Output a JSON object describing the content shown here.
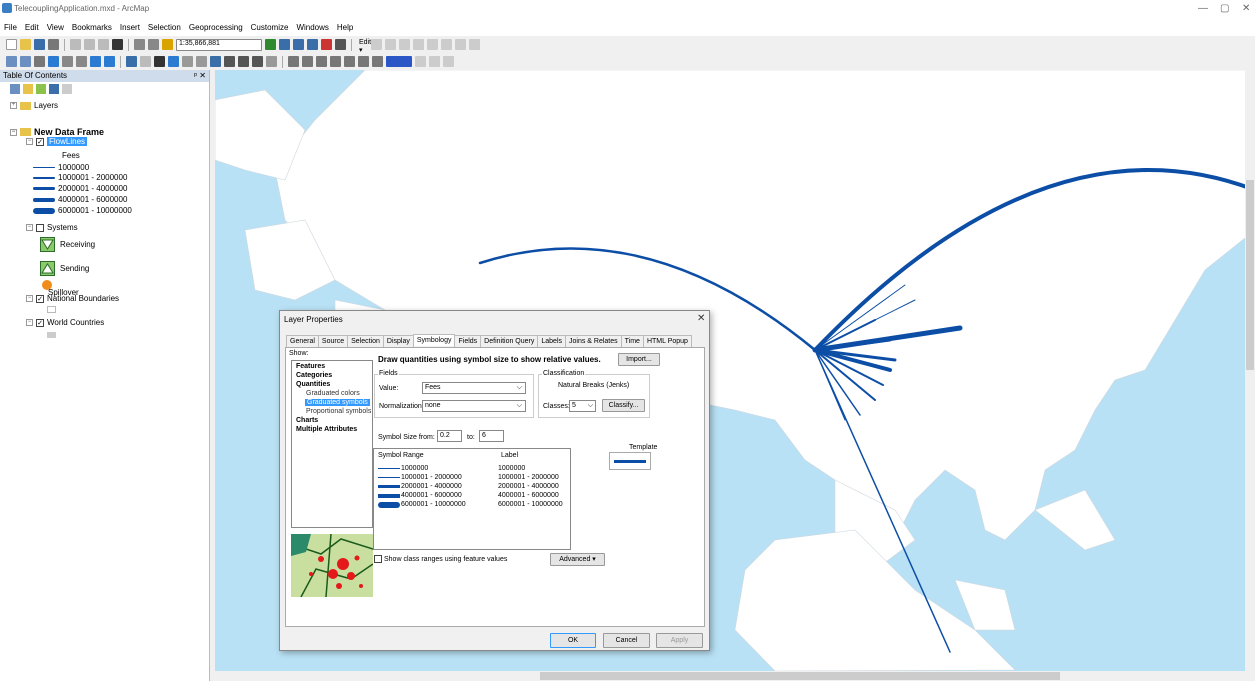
{
  "app": {
    "title": "TelecouplingApplication.mxd - ArcMap",
    "min": "—",
    "max": "▢",
    "close": "✕"
  },
  "menu": [
    "File",
    "Edit",
    "View",
    "Bookmarks",
    "Insert",
    "Selection",
    "Geoprocessing",
    "Customize",
    "Windows",
    "Help"
  ],
  "toolbar": {
    "scale": "1:35,866,881",
    "editor": "Editor ▾"
  },
  "toc": {
    "title": "Table Of Contents",
    "pin": "ᵖ ✕",
    "layers_root": "Layers",
    "frame": "New Data Frame",
    "flowlines": "FlowLines",
    "field": "Fees",
    "classes": [
      "1000000",
      "1000001 - 2000000",
      "2000001 - 4000000",
      "4000001 - 6000000",
      "6000001 - 10000000"
    ],
    "systems": "Systems",
    "receiving": "Receiving",
    "sending": "Sending",
    "spillover": "Spillover",
    "national": "National Boundaries",
    "world": "World Countries"
  },
  "colors": {
    "flow": "#0c4ea6",
    "ocean": "#b9e1f5",
    "land": "#ffffff",
    "selection": "#3399ff"
  },
  "dialog": {
    "title": "Layer Properties",
    "close": "✕",
    "tabs": [
      "General",
      "Source",
      "Selection",
      "Display",
      "Symbology",
      "Fields",
      "Definition Query",
      "Labels",
      "Joins & Relates",
      "Time",
      "HTML Popup"
    ],
    "active_tab": "Symbology",
    "show_label": "Show:",
    "show_items": {
      "features": "Features",
      "categories": "Categories",
      "quantities": "Quantities",
      "graduated_colors": "Graduated colors",
      "graduated_symbols": "Graduated symbols",
      "proportional_symbols": "Proportional symbols",
      "charts": "Charts",
      "multiple_attributes": "Multiple Attributes"
    },
    "heading": "Draw quantities using symbol size to show relative values.",
    "import": "Import...",
    "fields_label": "Fields",
    "value_label": "Value:",
    "value": "Fees",
    "normalization_label": "Normalization:",
    "normalization": "none",
    "classification_label": "Classification",
    "classification": "Natural Breaks (Jenks)",
    "classes_label": "Classes:",
    "classes": "5",
    "classify": "Classify...",
    "symbol_size_from": "Symbol Size from:",
    "size_from": "0.2",
    "to_label": "to:",
    "size_to": "6",
    "template_label": "Template",
    "col_symbol": "Symbol",
    "col_range": "Range",
    "col_label": "Label",
    "rows": [
      {
        "range": "1000000",
        "label": "1000000"
      },
      {
        "range": "1000001 - 2000000",
        "label": "1000001 - 2000000"
      },
      {
        "range": "2000001 - 4000000",
        "label": "2000001 - 4000000"
      },
      {
        "range": "4000001 - 6000000",
        "label": "4000001 - 6000000"
      },
      {
        "range": "6000001 - 10000000",
        "label": "6000001 - 10000000"
      }
    ],
    "show_ranges": "Show class ranges using feature values",
    "advanced": "Advanced ▾",
    "ok": "OK",
    "cancel": "Cancel",
    "apply": "Apply"
  }
}
